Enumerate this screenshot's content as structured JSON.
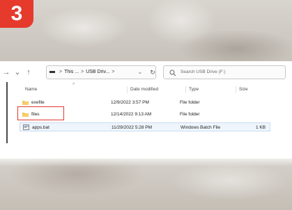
{
  "step_badge": "3",
  "nav": {
    "back_icon": "arrow-left-icon",
    "forward_icon": "chevron-down-icon",
    "up_icon": "arrow-up-icon",
    "breadcrumb": {
      "segment_1": "This ...",
      "segment_2": "USB Driv...",
      "separator": ">"
    },
    "search_placeholder": "Search USB Drive (F:)"
  },
  "columns": {
    "name": "Name",
    "date_modified": "Date modified",
    "type": "Type",
    "size": "Size"
  },
  "rows": [
    {
      "name": "exefile",
      "date": "12/9/2022 3:57 PM",
      "type": "File folder",
      "size": "",
      "icon": "folder-icon"
    },
    {
      "name": "files",
      "date": "12/14/2022 9:13 AM",
      "type": "File folder",
      "size": "",
      "icon": "folder-icon"
    },
    {
      "name": "apps.bat",
      "date": "11/29/2022 5:28 PM",
      "type": "Windows Batch File",
      "size": "1 KB",
      "icon": "batch-file-icon"
    }
  ],
  "colors": {
    "badge": "#e53a2c",
    "highlight": "#e03a2e",
    "folder": "#f2c14e",
    "selection": "#eef5fc"
  }
}
